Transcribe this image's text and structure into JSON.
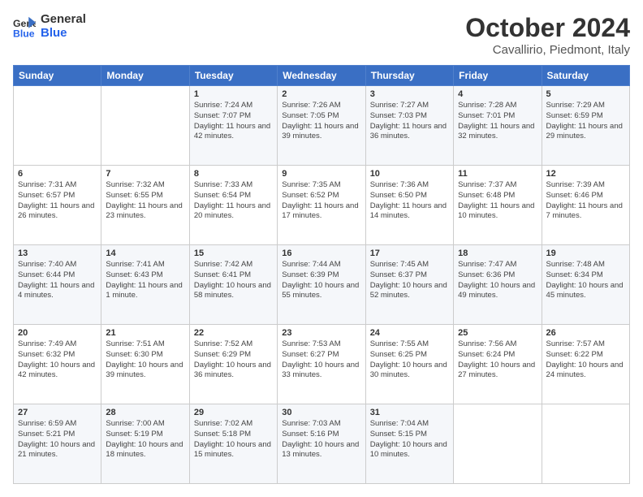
{
  "header": {
    "logo_general": "General",
    "logo_blue": "Blue",
    "month_title": "October 2024",
    "location": "Cavallirio, Piedmont, Italy"
  },
  "weekdays": [
    "Sunday",
    "Monday",
    "Tuesday",
    "Wednesday",
    "Thursday",
    "Friday",
    "Saturday"
  ],
  "weeks": [
    [
      {
        "day": "",
        "sunrise": "",
        "sunset": "",
        "daylight": ""
      },
      {
        "day": "",
        "sunrise": "",
        "sunset": "",
        "daylight": ""
      },
      {
        "day": "1",
        "sunrise": "Sunrise: 7:24 AM",
        "sunset": "Sunset: 7:07 PM",
        "daylight": "Daylight: 11 hours and 42 minutes."
      },
      {
        "day": "2",
        "sunrise": "Sunrise: 7:26 AM",
        "sunset": "Sunset: 7:05 PM",
        "daylight": "Daylight: 11 hours and 39 minutes."
      },
      {
        "day": "3",
        "sunrise": "Sunrise: 7:27 AM",
        "sunset": "Sunset: 7:03 PM",
        "daylight": "Daylight: 11 hours and 36 minutes."
      },
      {
        "day": "4",
        "sunrise": "Sunrise: 7:28 AM",
        "sunset": "Sunset: 7:01 PM",
        "daylight": "Daylight: 11 hours and 32 minutes."
      },
      {
        "day": "5",
        "sunrise": "Sunrise: 7:29 AM",
        "sunset": "Sunset: 6:59 PM",
        "daylight": "Daylight: 11 hours and 29 minutes."
      }
    ],
    [
      {
        "day": "6",
        "sunrise": "Sunrise: 7:31 AM",
        "sunset": "Sunset: 6:57 PM",
        "daylight": "Daylight: 11 hours and 26 minutes."
      },
      {
        "day": "7",
        "sunrise": "Sunrise: 7:32 AM",
        "sunset": "Sunset: 6:55 PM",
        "daylight": "Daylight: 11 hours and 23 minutes."
      },
      {
        "day": "8",
        "sunrise": "Sunrise: 7:33 AM",
        "sunset": "Sunset: 6:54 PM",
        "daylight": "Daylight: 11 hours and 20 minutes."
      },
      {
        "day": "9",
        "sunrise": "Sunrise: 7:35 AM",
        "sunset": "Sunset: 6:52 PM",
        "daylight": "Daylight: 11 hours and 17 minutes."
      },
      {
        "day": "10",
        "sunrise": "Sunrise: 7:36 AM",
        "sunset": "Sunset: 6:50 PM",
        "daylight": "Daylight: 11 hours and 14 minutes."
      },
      {
        "day": "11",
        "sunrise": "Sunrise: 7:37 AM",
        "sunset": "Sunset: 6:48 PM",
        "daylight": "Daylight: 11 hours and 10 minutes."
      },
      {
        "day": "12",
        "sunrise": "Sunrise: 7:39 AM",
        "sunset": "Sunset: 6:46 PM",
        "daylight": "Daylight: 11 hours and 7 minutes."
      }
    ],
    [
      {
        "day": "13",
        "sunrise": "Sunrise: 7:40 AM",
        "sunset": "Sunset: 6:44 PM",
        "daylight": "Daylight: 11 hours and 4 minutes."
      },
      {
        "day": "14",
        "sunrise": "Sunrise: 7:41 AM",
        "sunset": "Sunset: 6:43 PM",
        "daylight": "Daylight: 11 hours and 1 minute."
      },
      {
        "day": "15",
        "sunrise": "Sunrise: 7:42 AM",
        "sunset": "Sunset: 6:41 PM",
        "daylight": "Daylight: 10 hours and 58 minutes."
      },
      {
        "day": "16",
        "sunrise": "Sunrise: 7:44 AM",
        "sunset": "Sunset: 6:39 PM",
        "daylight": "Daylight: 10 hours and 55 minutes."
      },
      {
        "day": "17",
        "sunrise": "Sunrise: 7:45 AM",
        "sunset": "Sunset: 6:37 PM",
        "daylight": "Daylight: 10 hours and 52 minutes."
      },
      {
        "day": "18",
        "sunrise": "Sunrise: 7:47 AM",
        "sunset": "Sunset: 6:36 PM",
        "daylight": "Daylight: 10 hours and 49 minutes."
      },
      {
        "day": "19",
        "sunrise": "Sunrise: 7:48 AM",
        "sunset": "Sunset: 6:34 PM",
        "daylight": "Daylight: 10 hours and 45 minutes."
      }
    ],
    [
      {
        "day": "20",
        "sunrise": "Sunrise: 7:49 AM",
        "sunset": "Sunset: 6:32 PM",
        "daylight": "Daylight: 10 hours and 42 minutes."
      },
      {
        "day": "21",
        "sunrise": "Sunrise: 7:51 AM",
        "sunset": "Sunset: 6:30 PM",
        "daylight": "Daylight: 10 hours and 39 minutes."
      },
      {
        "day": "22",
        "sunrise": "Sunrise: 7:52 AM",
        "sunset": "Sunset: 6:29 PM",
        "daylight": "Daylight: 10 hours and 36 minutes."
      },
      {
        "day": "23",
        "sunrise": "Sunrise: 7:53 AM",
        "sunset": "Sunset: 6:27 PM",
        "daylight": "Daylight: 10 hours and 33 minutes."
      },
      {
        "day": "24",
        "sunrise": "Sunrise: 7:55 AM",
        "sunset": "Sunset: 6:25 PM",
        "daylight": "Daylight: 10 hours and 30 minutes."
      },
      {
        "day": "25",
        "sunrise": "Sunrise: 7:56 AM",
        "sunset": "Sunset: 6:24 PM",
        "daylight": "Daylight: 10 hours and 27 minutes."
      },
      {
        "day": "26",
        "sunrise": "Sunrise: 7:57 AM",
        "sunset": "Sunset: 6:22 PM",
        "daylight": "Daylight: 10 hours and 24 minutes."
      }
    ],
    [
      {
        "day": "27",
        "sunrise": "Sunrise: 6:59 AM",
        "sunset": "Sunset: 5:21 PM",
        "daylight": "Daylight: 10 hours and 21 minutes."
      },
      {
        "day": "28",
        "sunrise": "Sunrise: 7:00 AM",
        "sunset": "Sunset: 5:19 PM",
        "daylight": "Daylight: 10 hours and 18 minutes."
      },
      {
        "day": "29",
        "sunrise": "Sunrise: 7:02 AM",
        "sunset": "Sunset: 5:18 PM",
        "daylight": "Daylight: 10 hours and 15 minutes."
      },
      {
        "day": "30",
        "sunrise": "Sunrise: 7:03 AM",
        "sunset": "Sunset: 5:16 PM",
        "daylight": "Daylight: 10 hours and 13 minutes."
      },
      {
        "day": "31",
        "sunrise": "Sunrise: 7:04 AM",
        "sunset": "Sunset: 5:15 PM",
        "daylight": "Daylight: 10 hours and 10 minutes."
      },
      {
        "day": "",
        "sunrise": "",
        "sunset": "",
        "daylight": ""
      },
      {
        "day": "",
        "sunrise": "",
        "sunset": "",
        "daylight": ""
      }
    ]
  ]
}
